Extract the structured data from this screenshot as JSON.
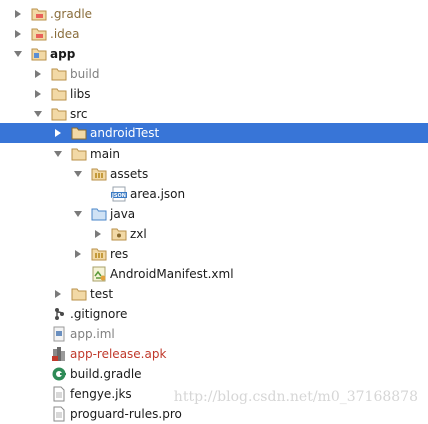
{
  "tree": {
    "items": [
      {
        "label": ".gradle",
        "icon": "folder-icon",
        "expanded": false
      },
      {
        "label": ".idea",
        "icon": "folder-icon",
        "expanded": false
      },
      {
        "label": "app",
        "icon": "module-folder-icon",
        "expanded": true
      },
      {
        "label": "build",
        "icon": "folder-icon",
        "expanded": false
      },
      {
        "label": "libs",
        "icon": "folder-icon",
        "expanded": false
      },
      {
        "label": "src",
        "icon": "folder-icon",
        "expanded": true
      },
      {
        "label": "androidTest",
        "icon": "folder-icon",
        "expanded": false,
        "selected": true
      },
      {
        "label": "main",
        "icon": "folder-icon",
        "expanded": true
      },
      {
        "label": "assets",
        "icon": "resources-folder-icon",
        "expanded": true
      },
      {
        "label": "area.json",
        "icon": "json-file-icon"
      },
      {
        "label": "java",
        "icon": "source-folder-icon",
        "expanded": true
      },
      {
        "label": "zxl",
        "icon": "package-icon",
        "expanded": false
      },
      {
        "label": "res",
        "icon": "resources-folder-icon",
        "expanded": false
      },
      {
        "label": "AndroidManifest.xml",
        "icon": "manifest-file-icon"
      },
      {
        "label": "test",
        "icon": "folder-icon",
        "expanded": false
      },
      {
        "label": ".gitignore",
        "icon": "git-file-icon"
      },
      {
        "label": "app.iml",
        "icon": "iml-file-icon"
      },
      {
        "label": "app-release.apk",
        "icon": "apk-file-icon"
      },
      {
        "label": "build.gradle",
        "icon": "gradle-file-icon"
      },
      {
        "label": "fengye.jks",
        "icon": "file-icon"
      },
      {
        "label": "proguard-rules.pro",
        "icon": "file-icon"
      }
    ]
  },
  "watermark": "http://blog.csdn.net/m0_37168878",
  "colors": {
    "selection": "#3875d7",
    "folder": "#d4b06a",
    "excluded_text": "#808080",
    "apk_text": "#c0392b"
  }
}
